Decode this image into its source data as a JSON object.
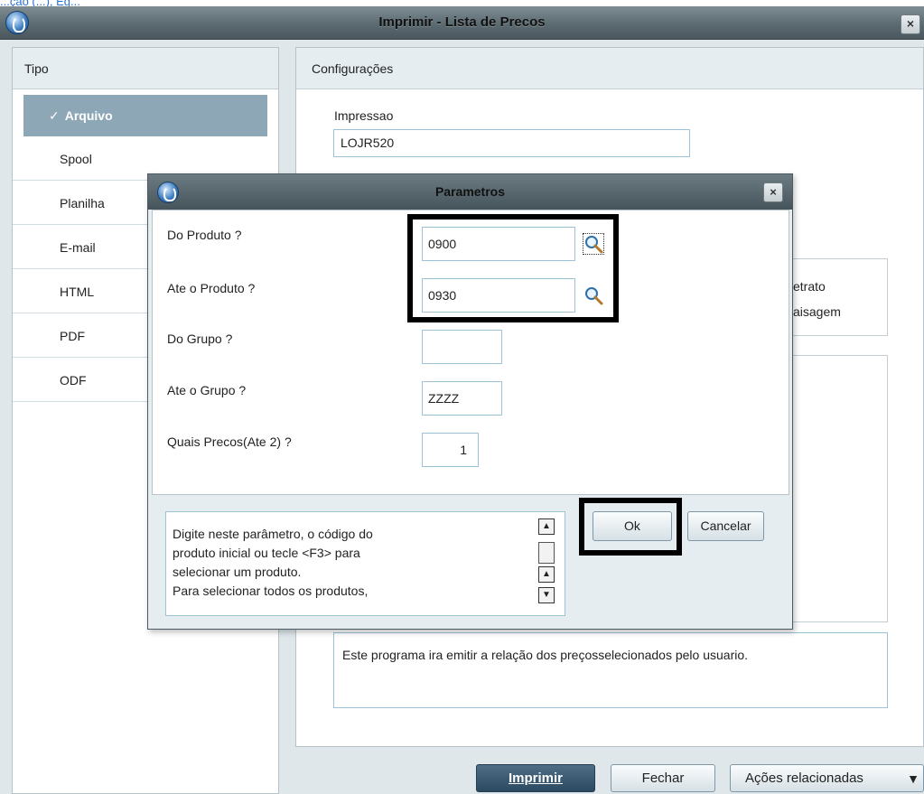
{
  "window": {
    "title": "Imprimir - Lista de Precos",
    "close_label": "×",
    "top_link": "...ção (...), Eg..."
  },
  "tipo": {
    "header": "Tipo",
    "active_check": "✓",
    "items": [
      "Arquivo",
      "Spool",
      "Planilha",
      "E-mail",
      "HTML",
      "PDF",
      "ODF"
    ]
  },
  "config": {
    "header": "Configurações",
    "impressao_label": "Impressao",
    "impressao_value": "LOJR520",
    "orientation_retrato": "etrato",
    "orientation_paisagem": "aisagem",
    "description": "Este programa ira emitir a relação dos preçosselecionados pelo usuario."
  },
  "footer": {
    "imprimir_label": "Imprimir",
    "fechar_label": "Fechar",
    "acoes_label": "Ações relacionadas",
    "acoes_caret": "▼"
  },
  "dialog": {
    "title": "Parametros",
    "close_label": "×",
    "params": [
      {
        "label": "Do Produto ?",
        "value": "0900"
      },
      {
        "label": "Ate o Produto ?",
        "value": "0930"
      },
      {
        "label": "Do Grupo ?",
        "value": ""
      },
      {
        "label": "Ate o Grupo ?",
        "value": "ZZZZ"
      },
      {
        "label": "Quais Precos(Ate 2) ?",
        "value": "1"
      }
    ],
    "help_text": "Digite neste parâmetro, o código do\nproduto inicial ou tecle <F3> para\nselecionar um produto.\nPara selecionar todos os produtos,",
    "ok_label": "Ok",
    "cancelar_label": "Cancelar"
  },
  "colors": {
    "titlebar": "#5c6b72",
    "active_tab": "#8ea7b7",
    "primary_button": "#2b4a62",
    "field_border": "#9cc3d8",
    "highlight": "#000000"
  }
}
